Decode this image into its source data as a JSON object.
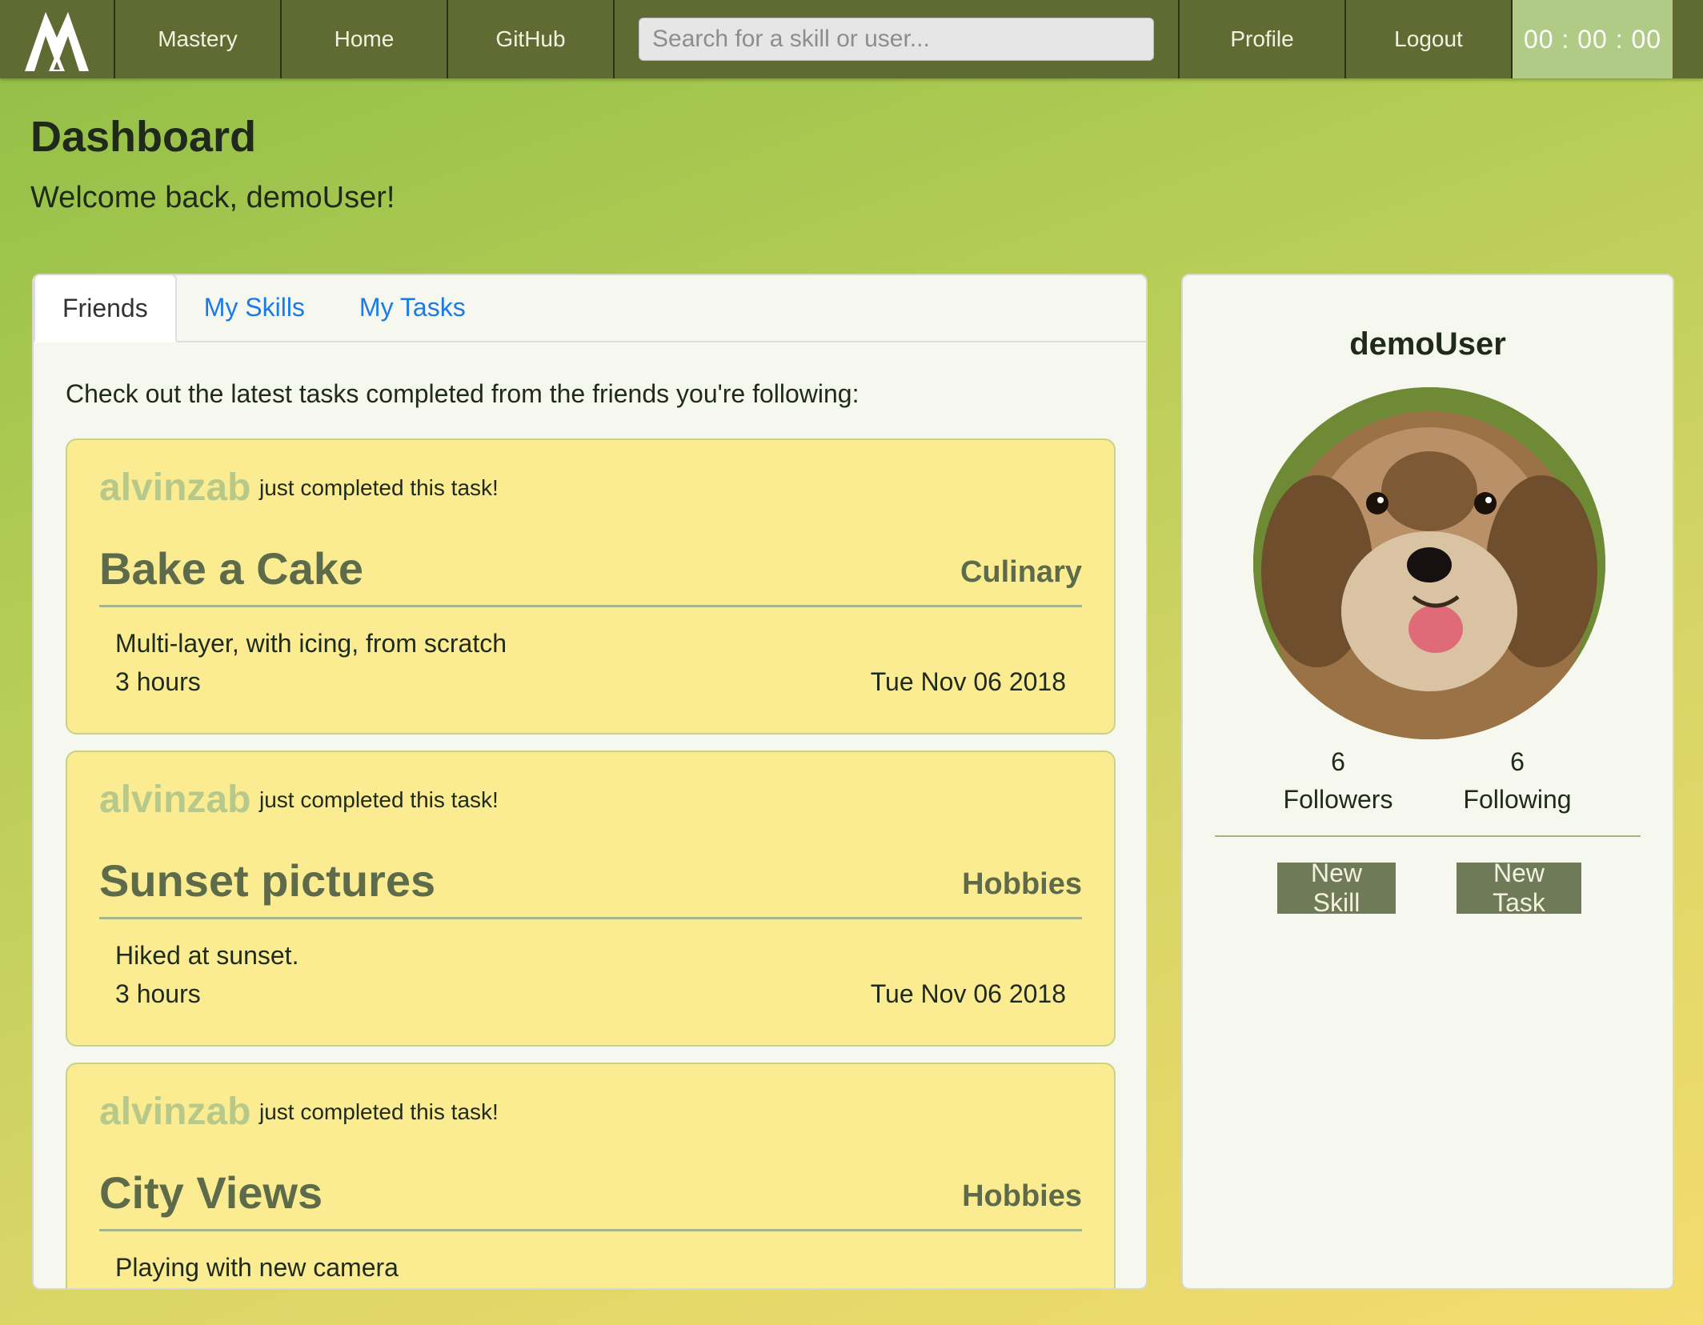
{
  "nav": {
    "brand": "Mastery",
    "home": "Home",
    "github": "GitHub",
    "search_placeholder": "Search for a skill or user...",
    "profile": "Profile",
    "logout": "Logout",
    "timer": "00 : 00 : 00",
    "logo_icon": "mountain-m-logo-icon"
  },
  "header": {
    "title": "Dashboard",
    "welcome": "Welcome back, demoUser!"
  },
  "tabs": [
    {
      "label": "Friends",
      "active": true
    },
    {
      "label": "My Skills",
      "active": false
    },
    {
      "label": "My Tasks",
      "active": false
    }
  ],
  "feed": {
    "intro": "Check out the latest tasks completed from the friends you're following:",
    "items": [
      {
        "user": "alvinzab",
        "action": "just completed this task!",
        "title": "Bake a Cake",
        "category": "Culinary",
        "description": "Multi-layer, with icing, from scratch",
        "duration": "3 hours",
        "date": "Tue Nov 06 2018"
      },
      {
        "user": "alvinzab",
        "action": "just completed this task!",
        "title": "Sunset pictures",
        "category": "Hobbies",
        "description": "Hiked at sunset.",
        "duration": "3 hours",
        "date": "Tue Nov 06 2018"
      },
      {
        "user": "alvinzab",
        "action": "just completed this task!",
        "title": "City Views",
        "category": "Hobbies",
        "description": "Playing with new camera",
        "duration": "",
        "date": ""
      }
    ]
  },
  "profile": {
    "username": "demoUser",
    "avatar_icon": "puppy-avatar",
    "followers_count": "6",
    "followers_label": "Followers",
    "following_count": "6",
    "following_label": "Following",
    "new_skill": "New Skill",
    "new_task": "New Task"
  },
  "colors": {
    "navbar": "#5f6b33",
    "timer_bg": "#b0cb85",
    "card_bg": "#fbec92",
    "username_green": "#b7c98a",
    "title_green": "#5e6b4a",
    "tab_link": "#1a7ae8",
    "button_bg": "#6f7a58"
  }
}
